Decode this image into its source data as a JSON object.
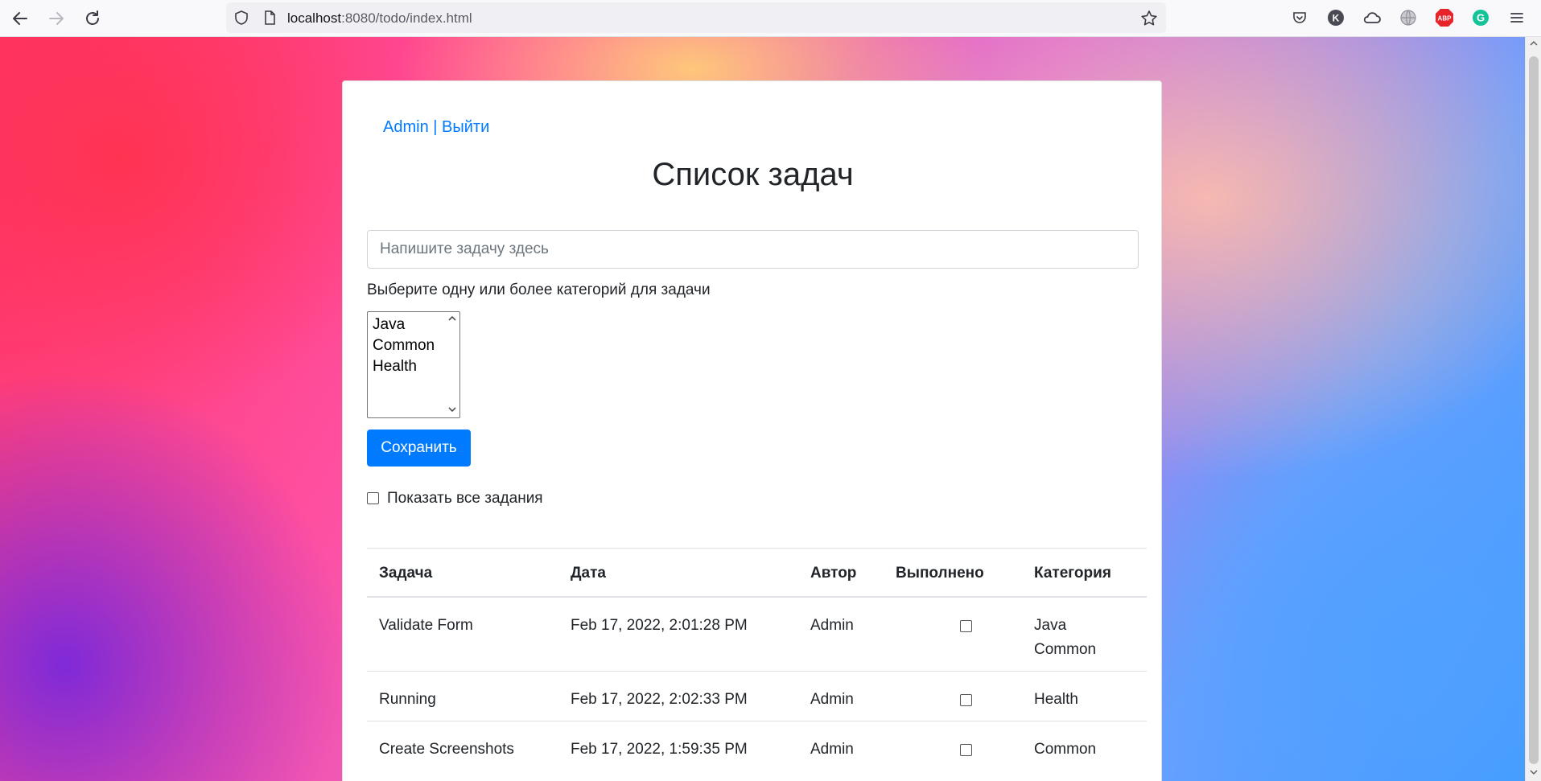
{
  "browser": {
    "url_host": "localhost",
    "url_rest": ":8080/todo/index.html"
  },
  "header": {
    "user_name": "Admin",
    "separator": "|",
    "logout_label": "Выйти"
  },
  "page_title": "Список задач",
  "task_input": {
    "placeholder": "Напишите задачу здесь",
    "value": ""
  },
  "categories": {
    "label": "Выберите одну или более категорий для задачи",
    "options": [
      "Java",
      "Common",
      "Health"
    ]
  },
  "save_label": "Сохранить",
  "show_all": {
    "label": "Показать все задания",
    "checked": false
  },
  "table": {
    "headers": [
      "Задача",
      "Дата",
      "Автор",
      "Выполнено",
      "Категория"
    ],
    "rows": [
      {
        "task": "Validate Form",
        "date": "Feb 17, 2022, 2:01:28 PM",
        "author": "Admin",
        "done": false,
        "categories": [
          "Java",
          "Common"
        ]
      },
      {
        "task": "Running",
        "date": "Feb 17, 2022, 2:02:33 PM",
        "author": "Admin",
        "done": false,
        "categories": [
          "Health"
        ]
      },
      {
        "task": "Create Screenshots",
        "date": "Feb 17, 2022, 1:59:35 PM",
        "author": "Admin",
        "done": false,
        "categories": [
          "Common"
        ]
      }
    ]
  },
  "colors": {
    "accent": "#007bff",
    "text": "#212529",
    "border": "#dee2e6"
  },
  "icons": {
    "toolbar": [
      "back-arrow-icon",
      "forward-arrow-icon",
      "reload-icon",
      "shield-icon",
      "page-icon",
      "star-icon",
      "pocket-icon",
      "profile-k-icon",
      "cloud-icon",
      "globe-icon",
      "adblock-icon",
      "grammarly-icon",
      "menu-icon"
    ]
  }
}
